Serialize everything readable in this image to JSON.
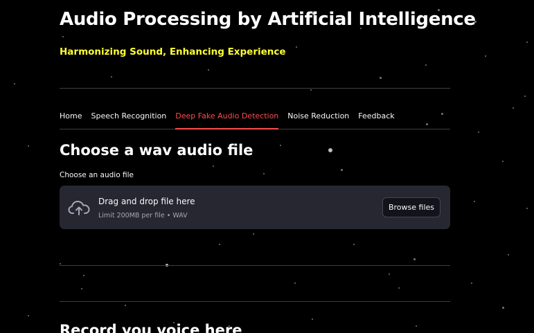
{
  "header": {
    "title": "Audio Processing by Artificial Intelligence",
    "subtitle": "Harmonizing Sound, Enhancing Experience"
  },
  "tabs": [
    {
      "label": "Home",
      "active": false
    },
    {
      "label": "Speech Recognition",
      "active": false
    },
    {
      "label": "Deep Fake Audio Detection",
      "active": true
    },
    {
      "label": "Noise Reduction",
      "active": false
    },
    {
      "label": "Feedback",
      "active": false
    }
  ],
  "main": {
    "section_heading": "Choose a wav audio file",
    "uploader": {
      "label": "Choose an audio file",
      "drop_text": "Drag and drop file here",
      "limit_text": "Limit 200MB per file • WAV",
      "browse_label": "Browse files",
      "icon": "cloud-upload-icon"
    },
    "record_heading": "Record you voice here"
  },
  "colors": {
    "background": "#000000",
    "subtitle": "#ffff33",
    "active_tab": "#ff4b4b",
    "dropzone": "#262730",
    "divider": "#3d3f45"
  }
}
